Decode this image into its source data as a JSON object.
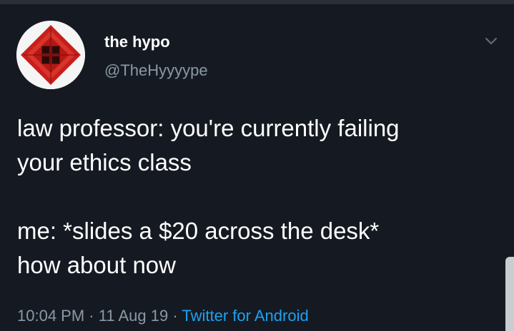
{
  "tweet": {
    "author": {
      "display_name": "the hypo",
      "handle": "@TheHyyyype",
      "avatar_icon": "red-diamond-seal-icon"
    },
    "menu_icon": "chevron-down-icon",
    "text_lines": [
      "law professor: you're currently failing",
      "your ethics class",
      "me: *slides a $20 across the desk*",
      "how about now"
    ],
    "time": "10:04 PM",
    "date": "11 Aug 19",
    "separator": "·",
    "source": "Twitter for Android"
  },
  "colors": {
    "background": "#151a22",
    "primary_text": "#ffffff",
    "secondary_text": "#8b98a5",
    "link": "#1da1f2",
    "avatar_red": "#d3231f"
  }
}
